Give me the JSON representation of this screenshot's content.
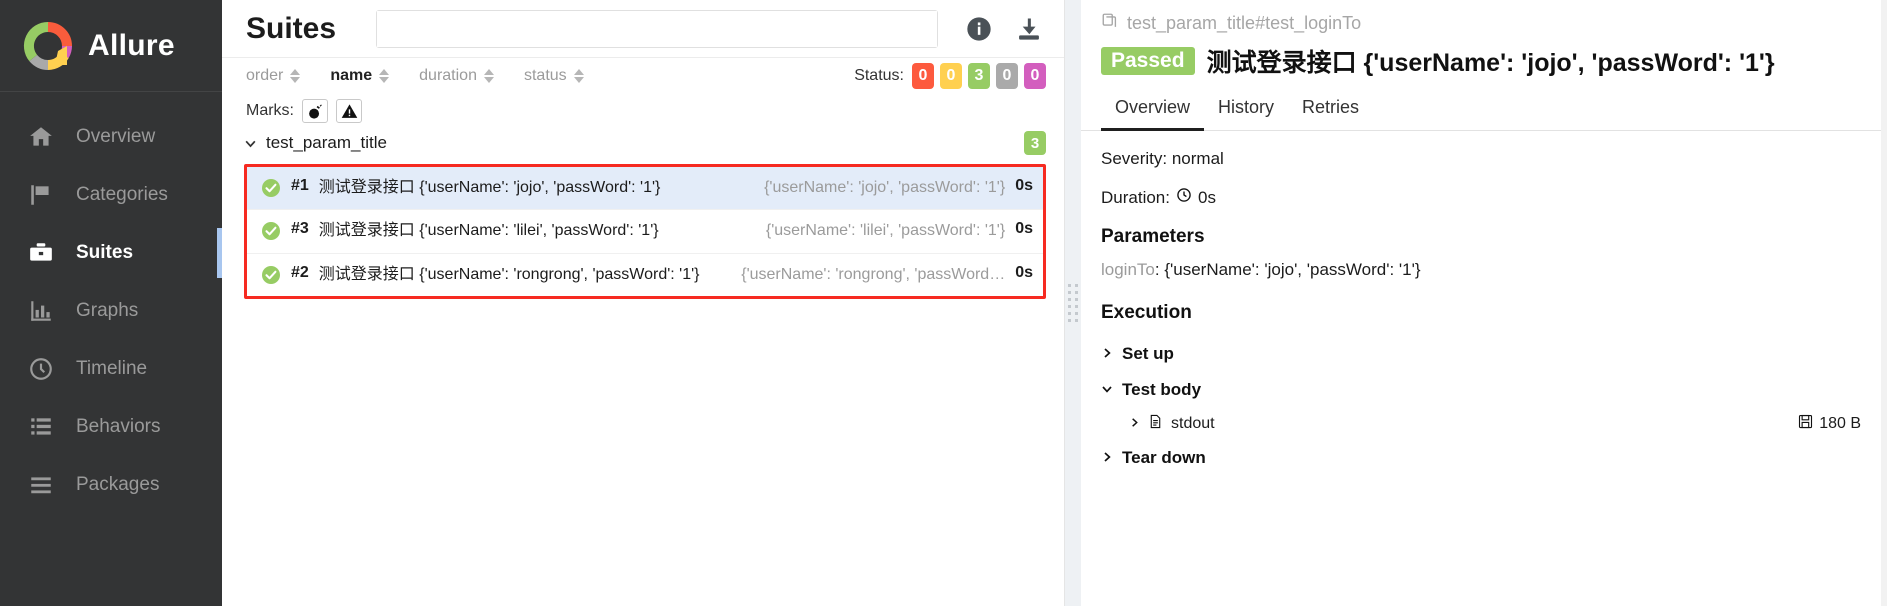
{
  "brand": {
    "name": "Allure",
    "logo_icon": "allure-logo-icon"
  },
  "sidebar": {
    "items": [
      {
        "label": "Overview",
        "icon": "home-icon",
        "active": false
      },
      {
        "label": "Categories",
        "icon": "flag-icon",
        "active": false
      },
      {
        "label": "Suites",
        "icon": "briefcase-icon",
        "active": true
      },
      {
        "label": "Graphs",
        "icon": "bar-chart-icon",
        "active": false
      },
      {
        "label": "Timeline",
        "icon": "clock-icon",
        "active": false
      },
      {
        "label": "Behaviors",
        "icon": "list-icon",
        "active": false
      },
      {
        "label": "Packages",
        "icon": "menu-icon",
        "active": false
      }
    ]
  },
  "suites_panel": {
    "title": "Suites",
    "search": {
      "value": "",
      "placeholder": ""
    },
    "info_icon": "info-icon",
    "download_icon": "download-icon",
    "sort_options": [
      {
        "label": "order",
        "active": false
      },
      {
        "label": "name",
        "active": true
      },
      {
        "label": "duration",
        "active": false
      },
      {
        "label": "status",
        "active": false
      }
    ],
    "status_filter": {
      "label": "Status:",
      "badges": [
        {
          "value": "0",
          "color": "#fd5a3e",
          "name": "failed"
        },
        {
          "value": "0",
          "color": "#ffd050",
          "name": "broken"
        },
        {
          "value": "3",
          "color": "#97cc64",
          "name": "passed"
        },
        {
          "value": "0",
          "color": "#aaaaaa",
          "name": "skipped"
        },
        {
          "value": "0",
          "color": "#d35ebe",
          "name": "unknown"
        }
      ]
    },
    "marks": {
      "label": "Marks:",
      "buttons": [
        {
          "name": "bomb-icon"
        },
        {
          "name": "warning-triangle-icon"
        }
      ]
    },
    "suite": {
      "name": "test_param_title",
      "count": "3",
      "expanded": true
    },
    "rows": [
      {
        "num": "#1",
        "name": "测试登录接口 {'userName': 'jojo', 'passWord': '1'}",
        "params": "{'userName': 'jojo', 'passWord': '1'}",
        "duration": "0s",
        "status": "passed",
        "selected": true
      },
      {
        "num": "#3",
        "name": "测试登录接口 {'userName': 'lilei', 'passWord': '1'}",
        "params": "{'userName': 'lilei', 'passWord': '1'}",
        "duration": "0s",
        "status": "passed",
        "selected": false
      },
      {
        "num": "#2",
        "name": "测试登录接口 {'userName': 'rongrong', 'passWord': '1'}",
        "params": "{'userName': 'rongrong', 'passWord…",
        "duration": "0s",
        "status": "passed",
        "selected": false
      }
    ]
  },
  "detail_panel": {
    "breadcrumb": "test_param_title#test_loginTo",
    "copy_icon": "copy-icon",
    "status_badge": "Passed",
    "title": "测试登录接口 {'userName': 'jojo', 'passWord': '1'}",
    "tabs": [
      {
        "label": "Overview",
        "active": true
      },
      {
        "label": "History",
        "active": false
      },
      {
        "label": "Retries",
        "active": false
      }
    ],
    "severity": "Severity: normal",
    "duration_label": "Duration:",
    "duration_value": "0s",
    "duration_icon": "clock-icon",
    "parameters_heading": "Parameters",
    "parameter": {
      "key": "loginTo",
      "value": ": {'userName': 'jojo', 'passWord': '1'}"
    },
    "execution_heading": "Execution",
    "execution_items": [
      {
        "label": "Set up",
        "expanded": false
      },
      {
        "label": "Test body",
        "expanded": true
      },
      {
        "label": "Tear down",
        "expanded": false
      }
    ],
    "attachment": {
      "label": "stdout",
      "file_icon": "file-icon",
      "size": "180 B",
      "size_icon": "floppy-save-icon"
    }
  }
}
